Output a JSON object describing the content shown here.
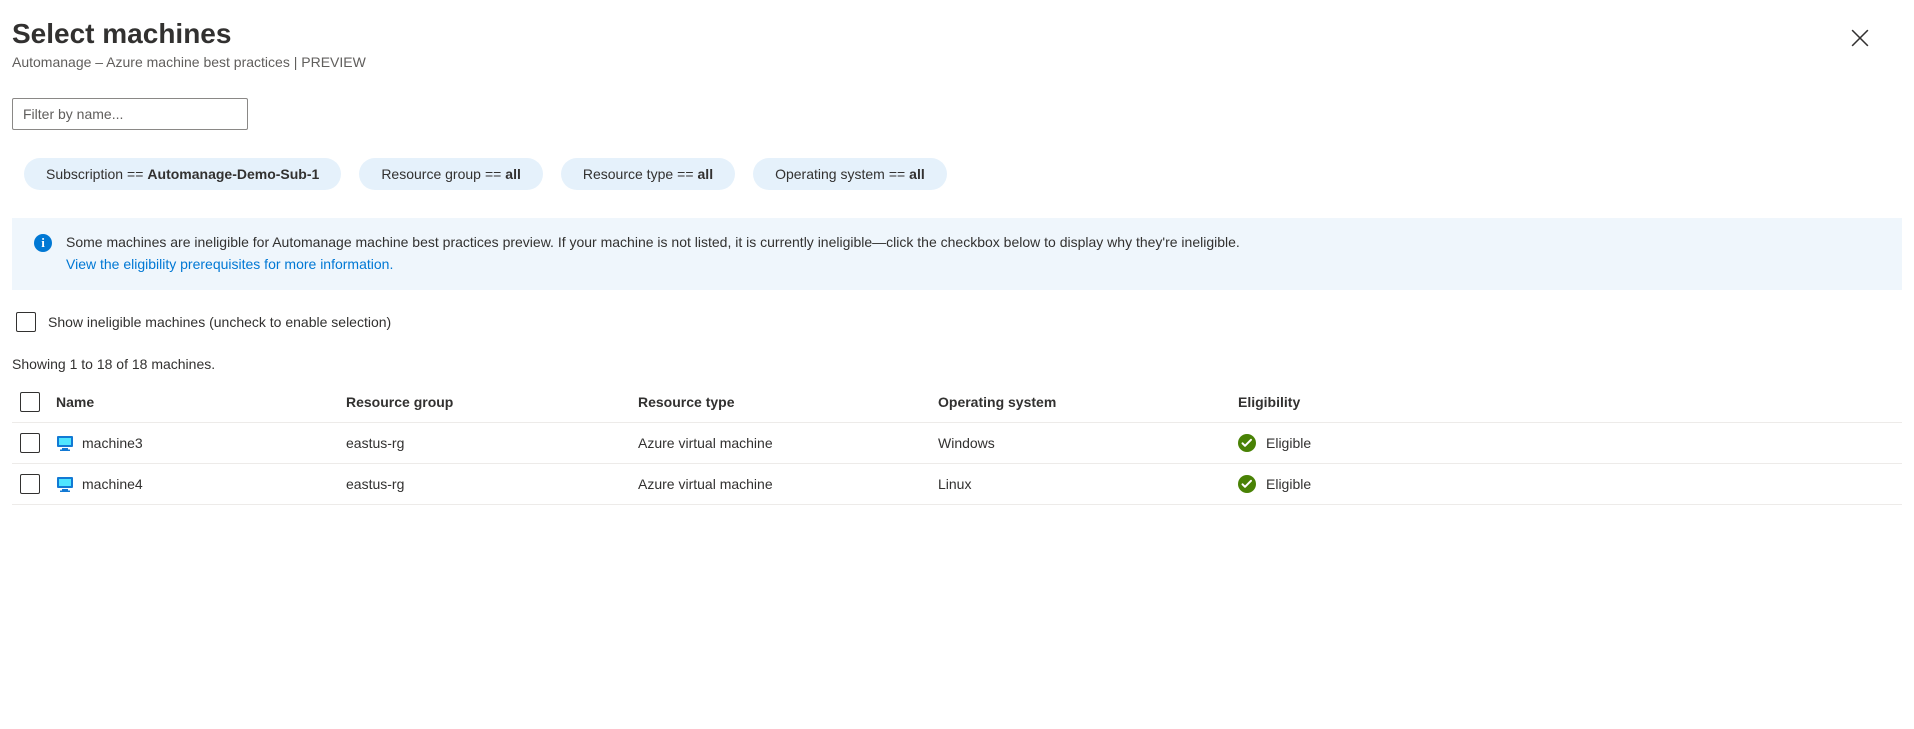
{
  "header": {
    "title": "Select machines",
    "subtitle": "Automanage – Azure machine best practices | PREVIEW"
  },
  "search": {
    "placeholder": "Filter by name..."
  },
  "filters": [
    {
      "label": "Subscription",
      "op": "==",
      "value": "Automanage-Demo-Sub-1"
    },
    {
      "label": "Resource group",
      "op": "==",
      "value": "all"
    },
    {
      "label": "Resource type",
      "op": "==",
      "value": "all"
    },
    {
      "label": "Operating system",
      "op": "==",
      "value": "all"
    }
  ],
  "info": {
    "text": "Some machines are ineligible for Automanage machine best practices preview. If your machine is not listed, it is currently ineligible—click the checkbox below to display why they're ineligible.",
    "link_text": "View the eligibility prerequisites for more information."
  },
  "ineligible_checkbox_label": "Show ineligible machines (uncheck to enable selection)",
  "count_text": "Showing 1 to 18 of 18 machines.",
  "columns": {
    "name": "Name",
    "rg": "Resource group",
    "rt": "Resource type",
    "os": "Operating system",
    "elig": "Eligibility"
  },
  "rows": [
    {
      "name": "machine3",
      "rg": "eastus-rg",
      "rt": "Azure virtual machine",
      "os": "Windows",
      "elig": "Eligible"
    },
    {
      "name": "machine4",
      "rg": "eastus-rg",
      "rt": "Azure virtual machine",
      "os": "Linux",
      "elig": "Eligible"
    }
  ],
  "colors": {
    "link": "#0078d4",
    "pill_bg": "#e5f1fb",
    "info_bg": "#eff6fc",
    "success": "#498205"
  }
}
